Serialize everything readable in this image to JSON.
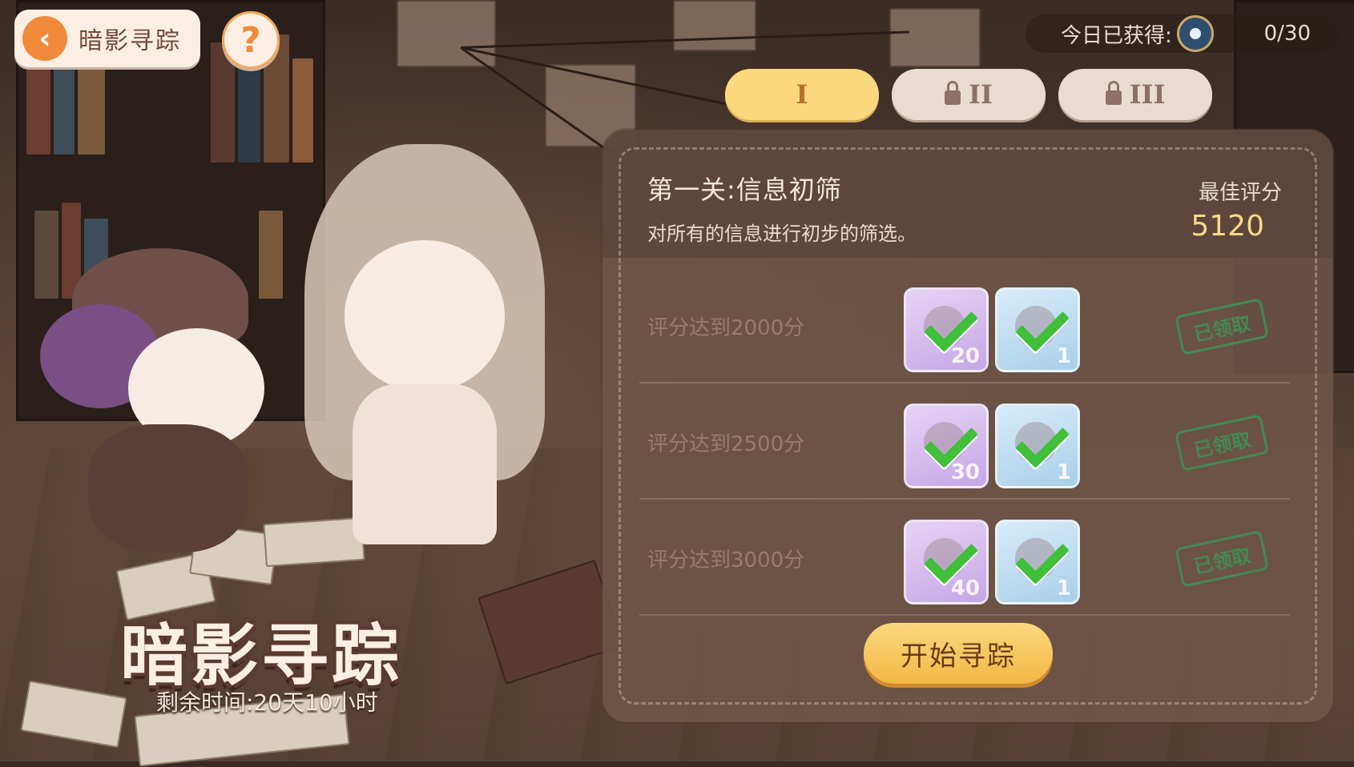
{
  "header": {
    "back_label": "暗影寻踪",
    "help_label": "?",
    "daily_label": "今日已获得:",
    "daily_value": "0/30"
  },
  "tabs": [
    {
      "label": "I",
      "state": "active"
    },
    {
      "label": "II",
      "state": "locked"
    },
    {
      "label": "III",
      "state": "locked"
    }
  ],
  "stage": {
    "title": "第一关:信息初筛",
    "description": "对所有的信息进行初步的筛选。",
    "best_label": "最佳评分",
    "best_value": "5120"
  },
  "tiers": [
    {
      "condition": "评分达到2000分",
      "rewards": [
        {
          "type": "purple",
          "qty": "20"
        },
        {
          "type": "blue",
          "qty": "1"
        }
      ],
      "status": "已领取"
    },
    {
      "condition": "评分达到2500分",
      "rewards": [
        {
          "type": "purple",
          "qty": "30"
        },
        {
          "type": "blue",
          "qty": "1"
        }
      ],
      "status": "已领取"
    },
    {
      "condition": "评分达到3000分",
      "rewards": [
        {
          "type": "purple",
          "qty": "40"
        },
        {
          "type": "blue",
          "qty": "1"
        }
      ],
      "status": "已领取"
    }
  ],
  "start_button": "开始寻踪",
  "event": {
    "logo": "暗影寻踪",
    "remaining": "剩余时间:20天10小时"
  },
  "colors": {
    "accent_yellow": "#fbd87e",
    "claimed_green": "#3f8f55",
    "check_green": "#3fbf3a",
    "back_orange": "#f08a3a"
  }
}
